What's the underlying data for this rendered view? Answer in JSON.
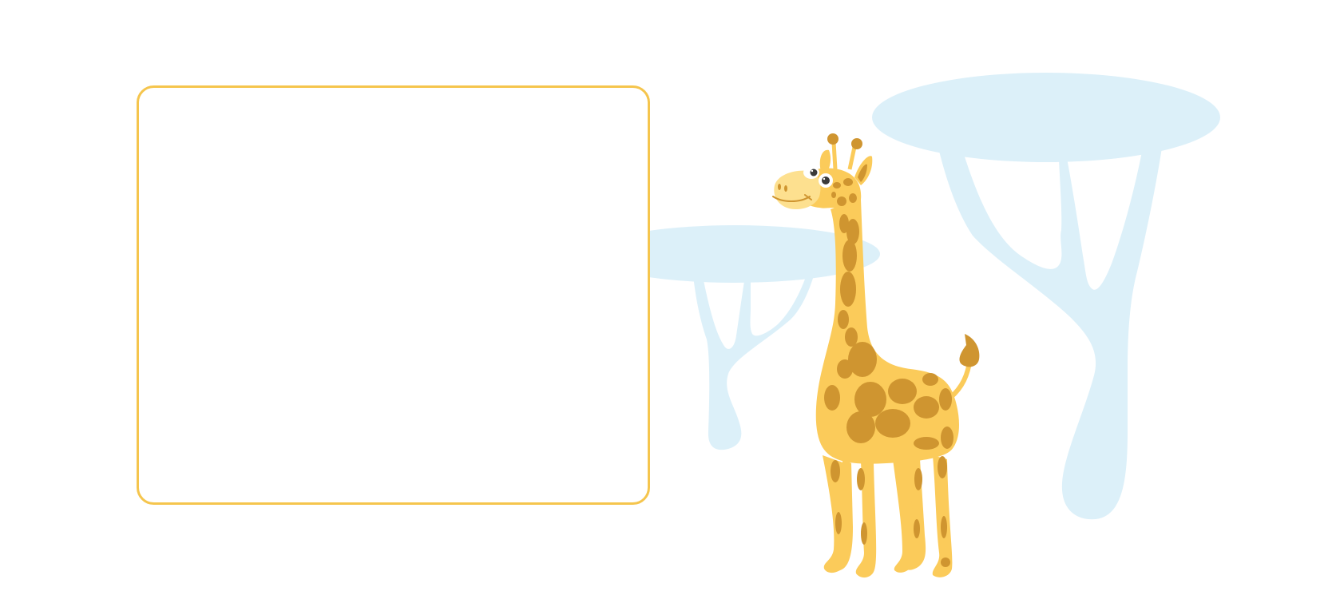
{
  "scene": {
    "frame_text": "",
    "colors": {
      "background": "#ffffff",
      "frame_border": "#f5c54d",
      "tree": "#dcf0f9",
      "giraffe_body": "#fbcb5a",
      "giraffe_spots": "#cf9530",
      "giraffe_muzzle": "#fde08f",
      "eye_white": "#ffffff",
      "eye_pupil": "#3a3a3a"
    },
    "icons": [
      "giraffe-illustration",
      "tree-illustration"
    ]
  }
}
